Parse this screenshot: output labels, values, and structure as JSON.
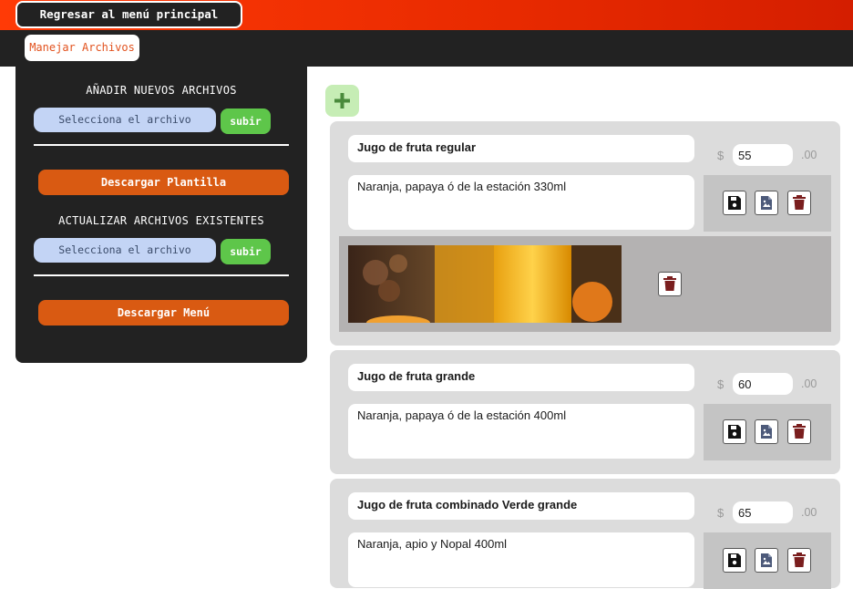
{
  "header": {
    "back_label": "Regresar al menú principal",
    "tab_label": "Manejar Archivos"
  },
  "sidebar": {
    "add_title": "AÑADIR NUEVOS ARCHIVOS",
    "file_picker_label": "Selecciona el archivo",
    "upload_label": "subir",
    "download_template_label": "Descargar Plantilla",
    "update_title": "ACTUALIZAR ARCHIVOS EXISTENTES",
    "download_menu_label": "Descargar Menú"
  },
  "add_button_icon": "plus-icon",
  "colors": {
    "accent_orange": "#d95a12",
    "header_red": "#e82a00",
    "upload_green": "#5ec64a",
    "dark_bg": "#222222",
    "delete_red": "#7a1e1e"
  },
  "products": [
    {
      "name": "Jugo de fruta regular",
      "description": "Naranja, papaya ó de la estación  330ml",
      "currency": "$",
      "price": "55",
      "cents": ".00",
      "has_image": true
    },
    {
      "name": "Jugo de fruta grande",
      "description": "Naranja, papaya ó de la estación  400ml",
      "currency": "$",
      "price": "60",
      "cents": ".00",
      "has_image": false
    },
    {
      "name": "Jugo de fruta combinado Verde grande",
      "description": "Naranja, apio y Nopal 400ml",
      "currency": "$",
      "price": "65",
      "cents": ".00",
      "has_image": false
    }
  ],
  "action_icons": [
    "save-icon",
    "image-icon",
    "trash-icon"
  ]
}
